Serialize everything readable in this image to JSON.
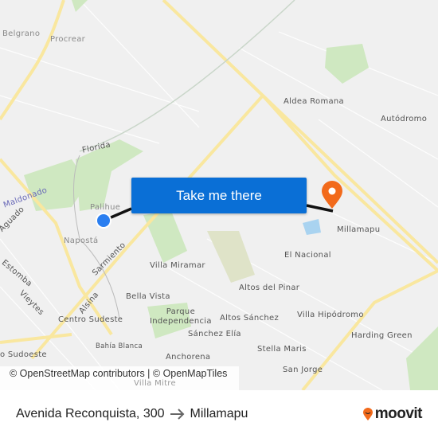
{
  "map": {
    "labels": {
      "belgrano": "Belgrano",
      "procrear": "Procrear",
      "florida": "Florida",
      "maldonado": "Maldonado",
      "palihue": "Palihue",
      "naposta": "Napostá",
      "sarmiento": "Sarmiento",
      "alsina": "Alsina",
      "estomba": "Estomba",
      "vieytes": "Vieytes",
      "aguado": "Aguado",
      "centro_sudeste": "Centro Sudeste",
      "sudoeste": "o Sudoeste",
      "bahia_blanca": "Bahía Blanca",
      "villa_miramar": "Villa Miramar",
      "bella_vista": "Bella Vista",
      "parque_independencia": "Parque\nIndependencia",
      "sanchez_elia": "Sánchez Elía",
      "anchorena": "Anchorena",
      "altos_sanchez": "Altos Sánchez",
      "altos_del_pinar": "Altos del Pinar",
      "el_nacional": "El Nacional",
      "villa_hipodromo": "Villa Hipódromo",
      "harding_green": "Harding Green",
      "stella_maris": "Stella Maris",
      "san_jorge": "San Jorge",
      "millamapu": "Millamapu",
      "aldea_romana": "Aldea Romana",
      "autodromo": "Autódromo",
      "villa_mitre": "Villa Mitre"
    },
    "cta_label": "Take me there",
    "attribution": "© OpenStreetMap contributors | © OpenMapTiles",
    "origin_marker_color": "#2a7ef0",
    "destination_marker_color": "#f26a1b",
    "route_color": "#111111"
  },
  "footer": {
    "origin": "Avenida Reconquista, 300",
    "arrow_icon": "arrow-right-icon",
    "destination": "Millamapu",
    "brand": "moovit"
  }
}
